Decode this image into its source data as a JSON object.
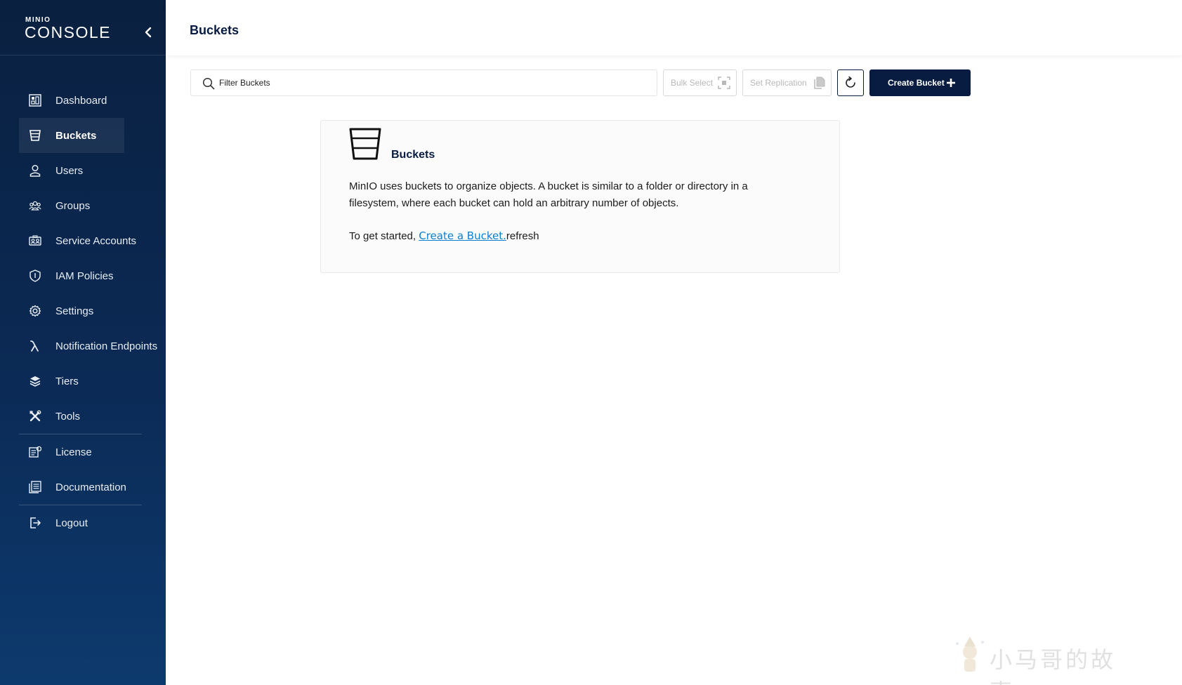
{
  "sidebar": {
    "logo_small": "MINIO",
    "logo_main": "CONSOLE",
    "items": [
      {
        "label": "Dashboard",
        "icon": "dashboard-icon"
      },
      {
        "label": "Buckets",
        "icon": "bucket-icon"
      },
      {
        "label": "Users",
        "icon": "user-icon"
      },
      {
        "label": "Groups",
        "icon": "groups-icon"
      },
      {
        "label": "Service Accounts",
        "icon": "service-accounts-icon"
      },
      {
        "label": "IAM Policies",
        "icon": "shield-icon"
      },
      {
        "label": "Settings",
        "icon": "gear-icon"
      },
      {
        "label": "Notification Endpoints",
        "icon": "lambda-icon"
      },
      {
        "label": "Tiers",
        "icon": "layers-icon"
      },
      {
        "label": "Tools",
        "icon": "tools-icon"
      },
      {
        "label": "License",
        "icon": "license-icon"
      },
      {
        "label": "Documentation",
        "icon": "documentation-icon"
      },
      {
        "label": "Logout",
        "icon": "logout-icon"
      }
    ],
    "active_item": "Buckets"
  },
  "header": {
    "title": "Buckets"
  },
  "toolbar": {
    "search_placeholder": "Filter Buckets",
    "bulk_select_label": "Bulk Select",
    "set_replication_label": "Set Replication",
    "create_bucket_label": "Create Bucket"
  },
  "empty_state": {
    "title": "Buckets",
    "description": "MinIO uses buckets to organize objects. A bucket is similar to a folder or directory in a filesystem, where each bucket can hold an arbitrary number of objects.",
    "start_prefix": "To get started, ",
    "link_text": "Create a Bucket.",
    "start_suffix": "refresh"
  },
  "watermark": {
    "text": "小马哥的故事"
  },
  "colors": {
    "sidebar_top": "#0a2040",
    "sidebar_bottom": "#0d3a6e",
    "primary": "#081c42",
    "link": "#0c7fd1"
  }
}
